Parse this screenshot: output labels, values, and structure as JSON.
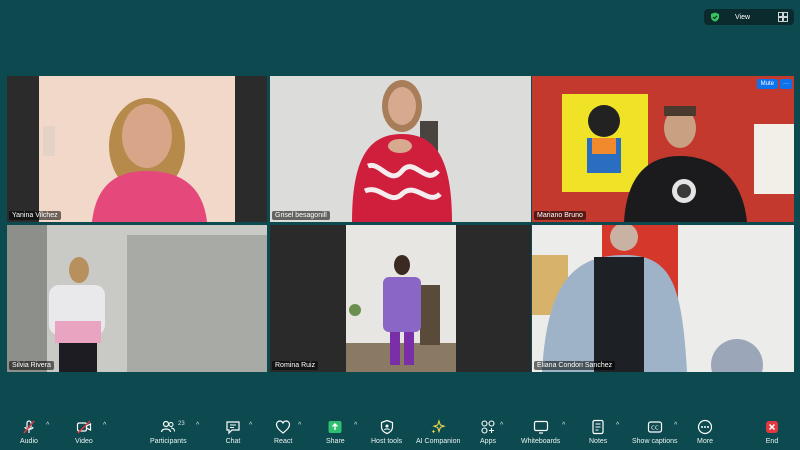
{
  "top_bar": {
    "view_label": "View"
  },
  "tiles": [
    {
      "name": "Yanina Vilchez"
    },
    {
      "name": "Grisel besagonill"
    },
    {
      "name": "Mariano Bruno",
      "mute_label": "Mute",
      "more_label": "···"
    },
    {
      "name": "Silvia Rivera"
    },
    {
      "name": "Romina Ruiz"
    },
    {
      "name": "Eliana Condori Sanchez"
    }
  ],
  "toolbar": {
    "audio": "Audio",
    "video": "Video",
    "participants": "Participants",
    "participants_count": "23",
    "chat": "Chat",
    "react": "React",
    "share": "Share",
    "host_tools": "Host tools",
    "ai_companion": "AI Companion",
    "apps": "Apps",
    "whiteboards": "Whiteboards",
    "notes": "Notes",
    "captions": "Show captions",
    "more": "More",
    "end": "End"
  },
  "colors": {
    "background": "#0d4a4f",
    "accent": "#0e72ed",
    "share_green": "#2fbf71",
    "end_red": "#e0383e",
    "shield_green": "#35c759"
  }
}
